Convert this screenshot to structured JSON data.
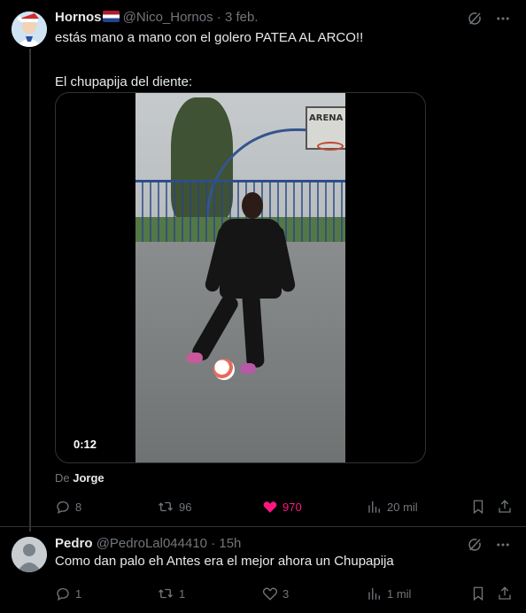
{
  "tweet1": {
    "name": "Hornos",
    "handle": "@Nico_Hornos",
    "sep": "·",
    "date": "3 feb.",
    "text_line1": "estás mano a mano con el golero PATEA AL ARCO!!",
    "text_line2": "El chupapija del diente:",
    "video": {
      "duration": "0:12",
      "sign_text": "ARENA"
    },
    "attribution": {
      "prefix": "De",
      "author": "Jorge"
    },
    "actions": {
      "replies": "8",
      "retweets": "96",
      "likes": "970",
      "views": "20 mil"
    },
    "colors": {
      "like": "#f91880"
    }
  },
  "tweet2": {
    "name": "Pedro",
    "handle": "@PedroLal044410",
    "sep": "·",
    "date": "15h",
    "text": "Como dan palo eh Antes era el mejor ahora un Chupapija",
    "actions": {
      "replies": "1",
      "retweets": "1",
      "likes": "3",
      "views": "1 mil"
    }
  },
  "icons": [
    "grok-icon",
    "more-icon",
    "reply-icon",
    "retweet-icon",
    "like-icon",
    "views-icon",
    "bookmark-icon",
    "share-icon",
    "netherlands-flag-icon"
  ]
}
